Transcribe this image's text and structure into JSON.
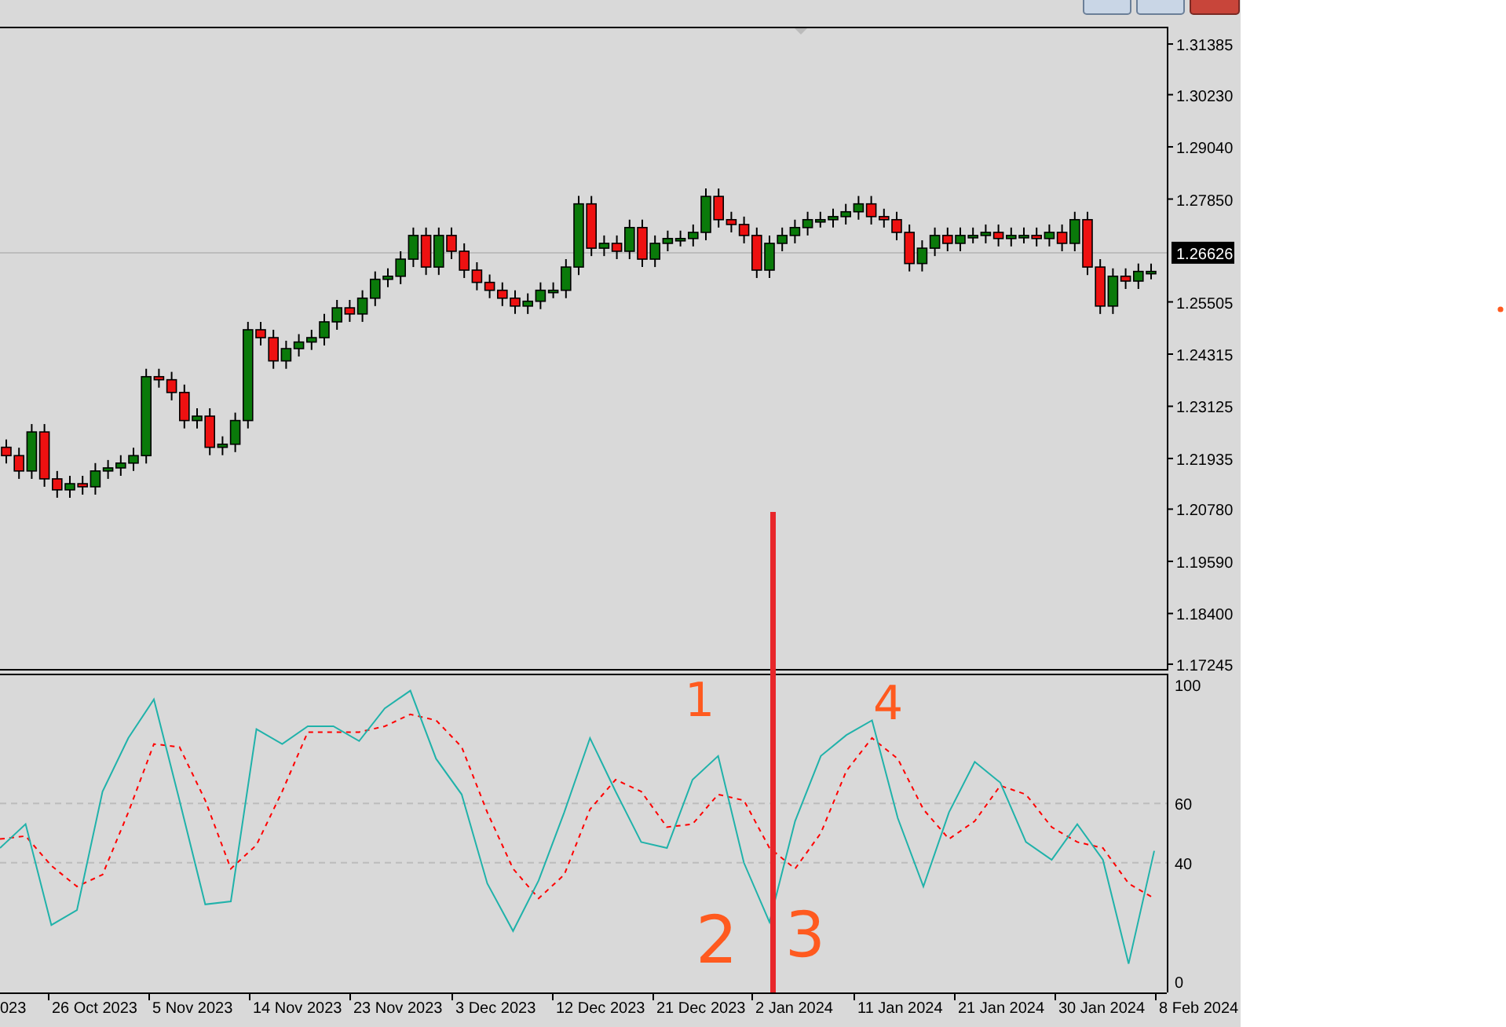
{
  "price_chart": {
    "chart_data": {
      "type": "candlestick",
      "ylim": [
        1.171,
        1.3178
      ],
      "yticks": [
        {
          "value": 1.31385,
          "label": "1.31385"
        },
        {
          "value": 1.3023,
          "label": "1.30230"
        },
        {
          "value": 1.2904,
          "label": "1.29040"
        },
        {
          "value": 1.2785,
          "label": "1.27850"
        },
        {
          "value": 1.25505,
          "label": "1.25505"
        },
        {
          "value": 1.24315,
          "label": "1.24315"
        },
        {
          "value": 1.23125,
          "label": "1.23125"
        },
        {
          "value": 1.21935,
          "label": "1.21935"
        },
        {
          "value": 1.2078,
          "label": "1.20780"
        },
        {
          "value": 1.1959,
          "label": "1.19590"
        },
        {
          "value": 1.184,
          "label": "1.18400"
        },
        {
          "value": 1.17245,
          "label": "1.17245"
        }
      ],
      "ref_lines": [
        {
          "axis": "y",
          "value": 1.26626,
          "label": "1.26626",
          "color": "#bdbdbd"
        }
      ],
      "ohlc": [
        [
          1.2219,
          1.2237,
          1.2182,
          1.22
        ],
        [
          1.22,
          1.2218,
          1.2147,
          1.2165
        ],
        [
          1.2165,
          1.2272,
          1.2147,
          1.2254
        ],
        [
          1.2254,
          1.2272,
          1.2129,
          1.2147
        ],
        [
          1.2147,
          1.2165,
          1.2104,
          1.2122
        ],
        [
          1.2122,
          1.2154,
          1.2104,
          1.2136
        ],
        [
          1.2136,
          1.2154,
          1.2111,
          1.2129
        ],
        [
          1.2129,
          1.2183,
          1.2111,
          1.2165
        ],
        [
          1.2165,
          1.219,
          1.2147,
          1.2172
        ],
        [
          1.2172,
          1.2201,
          1.2154,
          1.2183
        ],
        [
          1.2183,
          1.2218,
          1.2165,
          1.22
        ],
        [
          1.22,
          1.2398,
          1.2182,
          1.238
        ],
        [
          1.238,
          1.2398,
          1.2355,
          1.2373
        ],
        [
          1.2373,
          1.2391,
          1.2326,
          1.2344
        ],
        [
          1.2344,
          1.2362,
          1.2262,
          1.228
        ],
        [
          1.228,
          1.2308,
          1.2262,
          1.229
        ],
        [
          1.229,
          1.2308,
          1.2201,
          1.2219
        ],
        [
          1.2219,
          1.2244,
          1.2201,
          1.2226
        ],
        [
          1.2226,
          1.2298,
          1.2208,
          1.228
        ],
        [
          1.228,
          1.2505,
          1.2262,
          1.2487
        ],
        [
          1.2487,
          1.2505,
          1.2451,
          1.2469
        ],
        [
          1.2469,
          1.2487,
          1.2398,
          1.2416
        ],
        [
          1.2416,
          1.2462,
          1.2398,
          1.2444
        ],
        [
          1.2444,
          1.2477,
          1.2426,
          1.2459
        ],
        [
          1.2459,
          1.2487,
          1.2441,
          1.2469
        ],
        [
          1.2469,
          1.2523,
          1.2451,
          1.2505
        ],
        [
          1.2505,
          1.2555,
          1.2487,
          1.2537
        ],
        [
          1.2537,
          1.2555,
          1.2505,
          1.2523
        ],
        [
          1.2523,
          1.2577,
          1.2505,
          1.2559
        ],
        [
          1.2559,
          1.262,
          1.2541,
          1.2602
        ],
        [
          1.2602,
          1.2627,
          1.2584,
          1.2609
        ],
        [
          1.2609,
          1.2666,
          1.2591,
          1.2648
        ],
        [
          1.2648,
          1.272,
          1.263,
          1.2702
        ],
        [
          1.2702,
          1.272,
          1.2612,
          1.263
        ],
        [
          1.263,
          1.272,
          1.2612,
          1.2702
        ],
        [
          1.2702,
          1.272,
          1.2648,
          1.2666
        ],
        [
          1.2666,
          1.2684,
          1.2605,
          1.2623
        ],
        [
          1.2623,
          1.2641,
          1.2577,
          1.2595
        ],
        [
          1.2595,
          1.2613,
          1.2559,
          1.2577
        ],
        [
          1.2577,
          1.2595,
          1.2541,
          1.2559
        ],
        [
          1.2559,
          1.2577,
          1.2523,
          1.2541
        ],
        [
          1.2541,
          1.257,
          1.2523,
          1.2552
        ],
        [
          1.2552,
          1.2595,
          1.2534,
          1.2577
        ],
        [
          1.2577,
          1.2595,
          1.2559,
          1.2577
        ],
        [
          1.2577,
          1.2648,
          1.2559,
          1.263
        ],
        [
          1.263,
          1.2792,
          1.2612,
          1.2774
        ],
        [
          1.2774,
          1.2792,
          1.2655,
          1.2673
        ],
        [
          1.2673,
          1.2702,
          1.2655,
          1.2684
        ],
        [
          1.2684,
          1.2702,
          1.2648,
          1.2666
        ],
        [
          1.2666,
          1.2738,
          1.2648,
          1.272
        ],
        [
          1.272,
          1.2738,
          1.263,
          1.2648
        ],
        [
          1.2648,
          1.2702,
          1.263,
          1.2684
        ],
        [
          1.2684,
          1.2713,
          1.2666,
          1.2695
        ],
        [
          1.2695,
          1.2713,
          1.2677,
          1.2695
        ],
        [
          1.2695,
          1.2727,
          1.2677,
          1.2709
        ],
        [
          1.2709,
          1.2809,
          1.2691,
          1.2791
        ],
        [
          1.2791,
          1.2809,
          1.272,
          1.2738
        ],
        [
          1.2738,
          1.2756,
          1.2709,
          1.2727
        ],
        [
          1.2727,
          1.2745,
          1.2684,
          1.2702
        ],
        [
          1.2702,
          1.272,
          1.2605,
          1.2623
        ],
        [
          1.2623,
          1.2702,
          1.2605,
          1.2684
        ],
        [
          1.2684,
          1.272,
          1.2666,
          1.2702
        ],
        [
          1.2702,
          1.2738,
          1.2684,
          1.272
        ],
        [
          1.272,
          1.2756,
          1.2702,
          1.2738
        ],
        [
          1.2738,
          1.2756,
          1.272,
          1.2738
        ],
        [
          1.2738,
          1.2763,
          1.272,
          1.2745
        ],
        [
          1.2745,
          1.2774,
          1.2727,
          1.2756
        ],
        [
          1.2756,
          1.2792,
          1.2738,
          1.2774
        ],
        [
          1.2774,
          1.2792,
          1.2727,
          1.2745
        ],
        [
          1.2745,
          1.2763,
          1.272,
          1.2738
        ],
        [
          1.2738,
          1.2756,
          1.2691,
          1.2709
        ],
        [
          1.2709,
          1.2727,
          1.262,
          1.2638
        ],
        [
          1.2638,
          1.2691,
          1.262,
          1.2673
        ],
        [
          1.2673,
          1.272,
          1.2655,
          1.2702
        ],
        [
          1.2702,
          1.272,
          1.2666,
          1.2684
        ],
        [
          1.2684,
          1.272,
          1.2666,
          1.2702
        ],
        [
          1.2702,
          1.272,
          1.2684,
          1.2702
        ],
        [
          1.2702,
          1.2727,
          1.2684,
          1.2709
        ],
        [
          1.2709,
          1.2727,
          1.2677,
          1.2695
        ],
        [
          1.2695,
          1.272,
          1.2677,
          1.2702
        ],
        [
          1.2702,
          1.272,
          1.2684,
          1.2702
        ],
        [
          1.2702,
          1.272,
          1.2677,
          1.2695
        ],
        [
          1.2695,
          1.2727,
          1.2677,
          1.2709
        ],
        [
          1.2709,
          1.2727,
          1.2666,
          1.2684
        ],
        [
          1.2684,
          1.2756,
          1.2666,
          1.2738
        ],
        [
          1.2738,
          1.2756,
          1.2612,
          1.263
        ],
        [
          1.263,
          1.2648,
          1.2523,
          1.2541
        ],
        [
          1.2541,
          1.2627,
          1.2523,
          1.2609
        ],
        [
          1.2609,
          1.2627,
          1.258,
          1.2598
        ],
        [
          1.2598,
          1.2638,
          1.258,
          1.262
        ],
        [
          1.262,
          1.2638,
          1.2602,
          1.262
        ]
      ]
    }
  },
  "oscillator": {
    "chart_data": {
      "type": "line",
      "ylim": [
        -3.7,
        103.7
      ],
      "yticks": [
        100,
        60,
        40,
        0
      ],
      "series": [
        {
          "color": "#20b2aa",
          "line_style": "solid",
          "values": [
            45,
            53,
            19,
            24,
            64,
            82,
            95,
            61,
            26,
            27,
            85,
            80,
            86,
            86,
            81,
            92,
            98,
            75,
            63,
            33,
            17,
            34,
            57,
            82,
            64,
            47,
            45,
            68,
            76,
            40,
            20,
            54,
            76,
            83,
            88,
            55,
            32,
            57,
            74,
            67,
            47,
            41,
            53,
            41,
            6,
            44
          ]
        },
        {
          "color": "#ff0000",
          "line_style": "dashed",
          "values": [
            48,
            49,
            39,
            32,
            36,
            57,
            80,
            79,
            61,
            38,
            46,
            64,
            84,
            84,
            84,
            86,
            90,
            88,
            79,
            57,
            38,
            28,
            36,
            58,
            68,
            64,
            52,
            53,
            63,
            61,
            45,
            38,
            50,
            71,
            82,
            75,
            58,
            48,
            54,
            66,
            63,
            52,
            47,
            45,
            33,
            28
          ]
        }
      ]
    }
  },
  "time_axis": {
    "labels": [
      "023",
      "26 Oct 2023",
      "5 Nov 2023",
      "14 Nov 2023",
      "23 Nov 2023",
      "3 Dec 2023",
      "12 Dec 2023",
      "21 Dec 2023",
      "2 Jan 2024",
      "11 Jan 2024",
      "21 Jan 2024",
      "30 Jan 2024",
      "8 Feb 2024"
    ]
  },
  "annotations": [
    {
      "text": "1"
    },
    {
      "text": "4"
    },
    {
      "text": "2"
    },
    {
      "text": "3"
    }
  ]
}
